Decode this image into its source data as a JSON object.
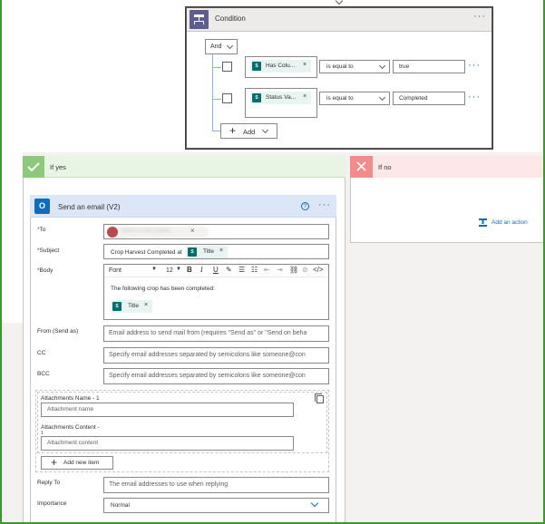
{
  "condition": {
    "title": "Condition",
    "group_operator": "And",
    "rows": [
      {
        "token": "Has Colu...",
        "operator": "is equal to",
        "value": "true"
      },
      {
        "token": "Status Va...",
        "operator": "is equal to",
        "value": "Completed"
      }
    ],
    "add_label": "Add",
    "more": "···"
  },
  "if_yes": {
    "title": "If yes"
  },
  "if_no": {
    "title": "If no",
    "add_action": "Add an action"
  },
  "email": {
    "title": "Send an email (V2)",
    "help": "?",
    "more": "···",
    "to_label": "To",
    "to_value": "Blurred User (Ligne)",
    "subject_label": "Subject",
    "subject_text": "Crop Harvest Completed at",
    "subject_token": "Title",
    "body_label": "Body",
    "font_select": "Font",
    "font_size": "12",
    "body_text": "The following crop has been completed:",
    "body_token": "Title",
    "from_label": "From (Send as)",
    "from_placeholder": "Email address to send mail from (requires \"Send as\" or \"Send on beha",
    "cc_label": "CC",
    "cc_placeholder": "Specify email addresses separated by semicolons like someone@con",
    "bcc_label": "BCC",
    "bcc_placeholder": "Specify email addresses separated by semicolons like someone@con",
    "attach_name_label": "Attachments Name - 1",
    "attach_name_placeholder": "Attachment name",
    "attach_content_label": "Attachments Content -",
    "attach_content_label2": "1",
    "attach_content_placeholder": "Attachment content",
    "add_item": "Add new item",
    "reply_label": "Reply To",
    "reply_placeholder": "The email addresses to use when replying",
    "importance_label": "Importance",
    "importance_value": "Normal"
  },
  "colors": {
    "frame": "#3a9b2a",
    "yes_bg": "#e8f5e4",
    "no_bg": "#fde7e9",
    "email_head": "#dbe7f6",
    "accent": "#0f6cbd"
  }
}
